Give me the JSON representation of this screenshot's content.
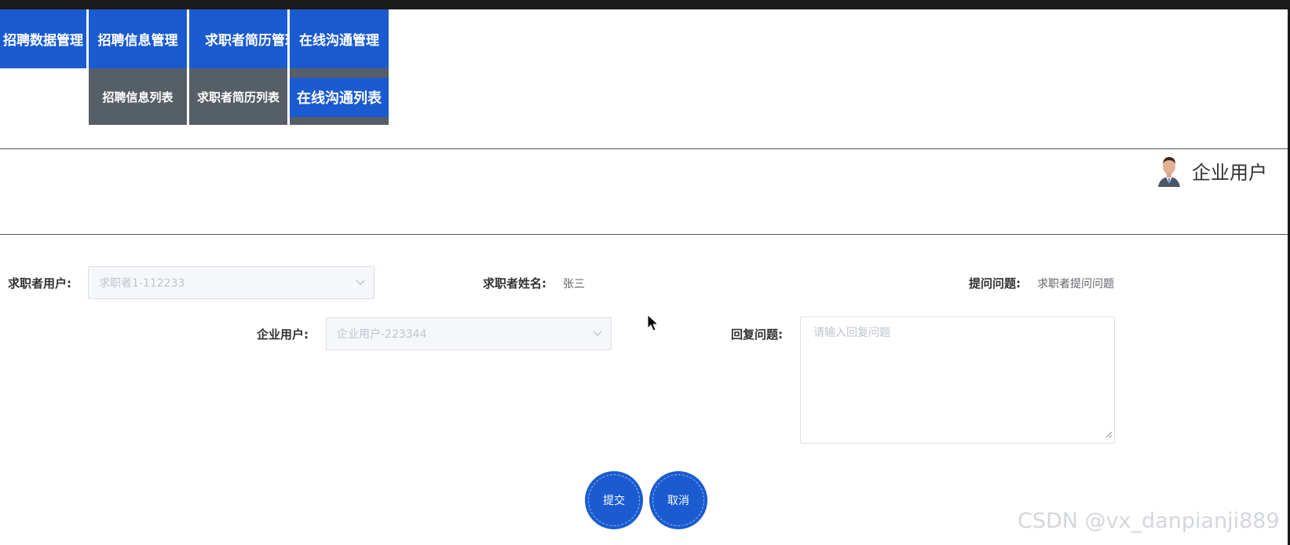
{
  "nav": {
    "menus": [
      {
        "label": "招聘数据管理"
      },
      {
        "label": "招聘信息管理",
        "sub": "招聘信息列表"
      },
      {
        "label": "求职者简历管理",
        "sub": "求职者简历列表"
      },
      {
        "label": "在线沟通管理",
        "sub": "在线沟通列表"
      }
    ]
  },
  "header": {
    "user_name": "企业用户"
  },
  "form": {
    "seeker_user": {
      "label": "求职者用户:",
      "value": "求职者1-112233"
    },
    "seeker_name": {
      "label": "求职者姓名:",
      "value": "张三"
    },
    "question": {
      "label": "提问问题:",
      "value": "求职者提问问题"
    },
    "company_user": {
      "label": "企业用户:",
      "value": "企业用户-223344"
    },
    "reply": {
      "label": "回复问题:",
      "placeholder": "请输入回复问题"
    },
    "submit_label": "提交",
    "cancel_label": "取消"
  },
  "watermark": "CSDN @vx_danpianji889",
  "colors": {
    "accent": "#1a5bd1",
    "submenu_bg": "#565e68"
  }
}
